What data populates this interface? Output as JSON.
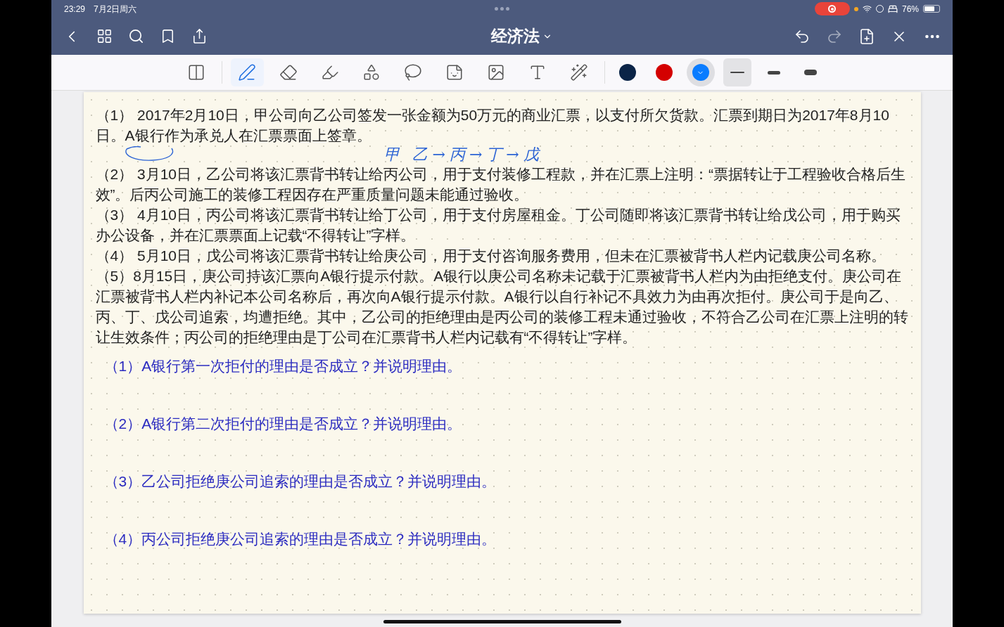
{
  "status_bar": {
    "time": "23:29",
    "date": "7月2日周六",
    "recording": true,
    "battery": "76%"
  },
  "nav": {
    "title": "经济法"
  },
  "tools": [
    {
      "selected": false
    },
    {
      "selected": true
    },
    {
      "selected": false
    },
    {
      "selected": false
    },
    {
      "selected": false
    },
    {
      "selected": false
    },
    {
      "selected": false
    },
    {
      "selected": false
    },
    {
      "selected": false
    },
    {
      "selected": false
    }
  ],
  "colors": [
    {
      "color": "#0b2447",
      "selected": false
    },
    {
      "color": "#d40000",
      "selected": false
    },
    {
      "color": "#0a7cff",
      "selected": true
    }
  ],
  "stroke_widths": [
    {
      "selected": true
    },
    {
      "selected": false
    },
    {
      "selected": false
    }
  ],
  "paragraphs": [
    "（1） 2017年2月10日，甲公司向乙公司签发一张金额为50万元的商业汇票，以支付所欠货款。汇票到期日为2017年8月10日。A银行作为承兑人在汇票票面上签章。",
    "（2） 3月10日，乙公司将该汇票背书转让给丙公司，用于支付装修工程款，并在汇票上注明：“票据转让于工程验收合格后生效”。后丙公司施工的装修工程因存在严重质量问题未能通过验收。",
    "（3） 4月10日，丙公司将该汇票背书转让给丁公司，用于支付房屋租金。丁公司随即将该汇票背书转让给戊公司，用于购买办公设备，并在汇票票面上记载“不得转让”字样。",
    "（4） 5月10日，戊公司将该汇票背书转让给庚公司，用于支付咨询服务费用，但未在汇票被背书人栏内记载庚公司名称。",
    "（5）8月15日，庚公司持该汇票向A银行提示付款。A银行以庚公司名称未记载于汇票被背书人栏内为由拒绝支付。庚公司在汇票被背书人栏内补记本公司名称后，再次向A银行提示付款。A银行以自行补记不具效力为由再次拒付。庚公司于是向乙、丙、丁、戊公司追索，均遭拒绝。其中，乙公司的拒绝理由是丙公司的装修工程未通过验收，不符合乙公司在汇票上注明的转让生效条件；丙公司的拒绝理由是丁公司在汇票背书人栏内记载有“不得转让”字样。"
  ],
  "questions": [
    "（1）A银行第一次拒付的理由是否成立？并说明理由。",
    "（2）A银行第二次拒付的理由是否成立？并说明理由。",
    "（3）乙公司拒绝庚公司追索的理由是否成立？并说明理由。",
    "（4）丙公司拒绝庚公司追索的理由是否成立？并说明理由。"
  ],
  "annotation": "甲 乙→丙→丁→戊"
}
